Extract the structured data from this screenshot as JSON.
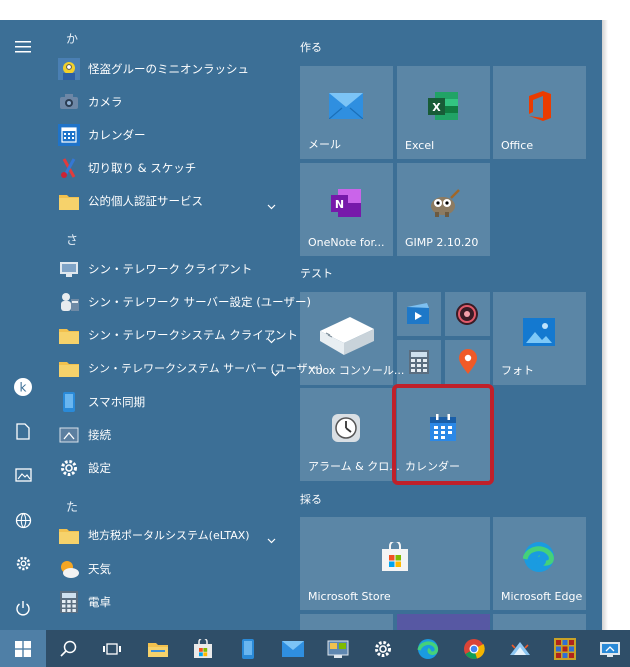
{
  "start_menu": {
    "app_list": {
      "letters": [
        "か",
        "さ",
        "た"
      ],
      "items": [
        {
          "label": "怪盗グルーのミニオンラッシュ",
          "icon": "minion-game-icon"
        },
        {
          "label": "カメラ",
          "icon": "camera-icon"
        },
        {
          "label": "カレンダー",
          "icon": "calendar-icon"
        },
        {
          "label": "切り取り & スケッチ",
          "icon": "snip-sketch-icon"
        },
        {
          "label": "公的個人認証サービス",
          "icon": "folder-icon",
          "expandable": true
        },
        {
          "label": "シン・テレワーク クライアント",
          "icon": "telework-client-icon"
        },
        {
          "label": "シン・テレワーク サーバー設定 (ユーザー)",
          "icon": "telework-server-icon"
        },
        {
          "label": "シン・テレワークシステム クライアント",
          "icon": "folder-icon",
          "expandable": true
        },
        {
          "label": "シン・テレワークシステム サーバー (ユーザー)",
          "icon": "folder-icon",
          "expandable": true
        },
        {
          "label": "スマホ同期",
          "icon": "phone-link-icon"
        },
        {
          "label": "接続",
          "icon": "connect-icon"
        },
        {
          "label": "設定",
          "icon": "gear-icon"
        },
        {
          "label": "地方税ポータルシステム(eLTAX)",
          "icon": "folder-icon",
          "expandable": true
        },
        {
          "label": "天気",
          "icon": "weather-icon"
        },
        {
          "label": "電卓",
          "icon": "calculator-icon"
        }
      ]
    },
    "tiles": {
      "groups": [
        {
          "title": "作る"
        },
        {
          "title": "テスト"
        },
        {
          "title": "採る"
        }
      ],
      "items": [
        {
          "label": "メール",
          "icon": "mail-icon"
        },
        {
          "label": "Excel",
          "icon": "excel-icon"
        },
        {
          "label": "Office",
          "icon": "office-icon"
        },
        {
          "label": "OneNote for...",
          "icon": "onenote-icon"
        },
        {
          "label": "GIMP 2.10.20",
          "icon": "gimp-icon"
        },
        {
          "label": "Xbox コンソール...",
          "icon": "xbox-console-icon"
        },
        {
          "label": "フォト",
          "icon": "photos-icon"
        },
        {
          "label": "アラーム & クロ...",
          "icon": "alarm-clock-icon"
        },
        {
          "label": "カレンダー",
          "icon": "calendar-icon"
        },
        {
          "label": "Microsoft Store",
          "icon": "store-icon"
        },
        {
          "label": "Microsoft Edge",
          "icon": "edge-icon"
        }
      ]
    }
  },
  "taskbar": {
    "icons": [
      "windows-start-icon",
      "search-icon",
      "task-view-icon",
      "file-explorer-icon",
      "store-icon",
      "phone-icon",
      "mail-icon",
      "control-panel-icon",
      "settings-icon",
      "edge-icon",
      "chrome-icon",
      "telework-icon",
      "game-icon",
      "remote-icon"
    ]
  },
  "colors": {
    "menu_bg": "#3c6f96",
    "tile_bg": "rgba(255,255,255,0.16)",
    "highlight": "#c0202a",
    "taskbar_bg": "#2f4e68"
  }
}
